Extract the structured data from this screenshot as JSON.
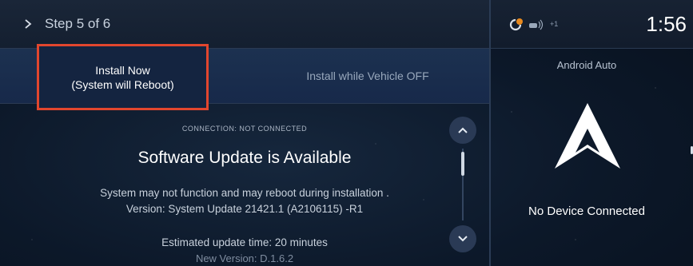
{
  "header": {
    "step_label": "Step 5 of 6"
  },
  "actions": {
    "install_now_line1": "Install Now",
    "install_now_line2": "(System will Reboot)",
    "install_vehicle_off": "Install while Vehicle OFF"
  },
  "content": {
    "connection": "CONNECTION: NOT CONNECTED",
    "title": "Software Update is Available",
    "description_line1": "System may not function and may reboot during installation .",
    "description_line2": "Version: System Update 21421.1 (A2106115) -R1",
    "estimated_time": "Estimated update time: 20 minutes",
    "new_version": "New Version:  D.1.6.2"
  },
  "status_bar": {
    "time": "1:56",
    "extra_count": "+1",
    "icons": [
      "phone-notification-icon",
      "vehicle-connection-icon"
    ],
    "alert_color": "#e8891e"
  },
  "android_auto": {
    "title": "Android Auto",
    "status": "No Device Connected"
  },
  "colors": {
    "highlight_border": "#e2462e"
  }
}
